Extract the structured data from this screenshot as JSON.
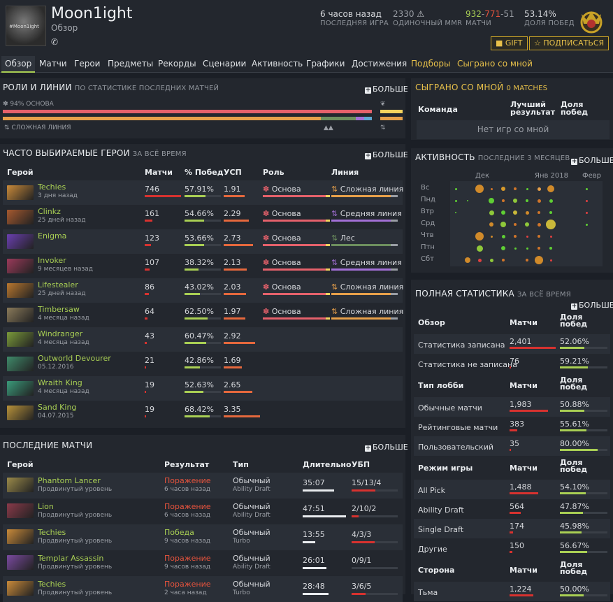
{
  "profile": {
    "name": "Moon1ight",
    "subtitle": "Обзор",
    "avatar_text": "#Moon1ight",
    "phone_icon": "phone-icon"
  },
  "stats": {
    "last_game": {
      "value": "6 часов назад",
      "label": "ПОСЛЕДНЯЯ ИГРА"
    },
    "mmr": {
      "value": "2330",
      "label": "ОДИНОЧНЫЙ MMR"
    },
    "matches": {
      "wins": "932",
      "losses": "771",
      "abandons": "51",
      "label": "МАТЧИ"
    },
    "winrate": {
      "value": "53.14%",
      "label": "ДОЛЯ ПОБЕД"
    }
  },
  "buttons": {
    "gift": "GIFT",
    "subscribe": "ПОДПИСАТЬСЯ"
  },
  "nav": [
    "Обзор",
    "Матчи",
    "Герои",
    "Предметы",
    "Рекорды",
    "Сценарии",
    "Активность",
    "Графики",
    "Достижения",
    "Подборы",
    "Сыграно со мной"
  ],
  "roles": {
    "title": "РОЛИ И ЛИНИИ",
    "subtitle": "ПО СТАТИСТИКЕ ПОСЛЕДНИХ МАТЧЕЙ",
    "more": "БОЛЬШЕ",
    "role_label": "94% ОСНОВА",
    "lane_label": "СЛОЖНАЯ ЛИНИЯ"
  },
  "played_with": {
    "title": "СЫГРАНО СО МНОЙ",
    "count": "0 MATCHES",
    "col_team": "Команда",
    "col_best": "Лучший результат",
    "col_winrate": "Доля побед",
    "empty": "Нет игр со мной"
  },
  "heroes": {
    "title": "ЧАСТО ВЫБИРАЕМЫЕ ГЕРОИ",
    "subtitle": "ЗА ВСЁ ВРЕМЯ",
    "more": "БОЛЬШЕ",
    "cols": {
      "hero": "Герой",
      "matches": "Матчи",
      "winrate": "% Побед",
      "kda": "УСП",
      "role": "Роль",
      "lane": "Линия"
    },
    "rows": [
      {
        "name": "Techies",
        "ago": "3 дня назад",
        "matches": "746",
        "m": 746,
        "winrate": "57.91%",
        "w": 57.91,
        "kda": "1.91",
        "k": 1.91,
        "role": "Основа",
        "lane": "Сложная линия",
        "lc": "#e7a04a",
        "c": "#c98a3a"
      },
      {
        "name": "Clinkz",
        "ago": "25 дней назад",
        "matches": "161",
        "m": 161,
        "winrate": "54.66%",
        "w": 54.66,
        "kda": "2.29",
        "k": 2.29,
        "role": "Основа",
        "lane": "Средняя линия",
        "lc": "#a26fd6",
        "c": "#a6592f"
      },
      {
        "name": "Enigma",
        "ago": "",
        "matches": "123",
        "m": 123,
        "winrate": "53.66%",
        "w": 53.66,
        "kda": "2.73",
        "k": 2.73,
        "role": "Основа",
        "lane": "Лес",
        "lc": "#6d8f5e",
        "c": "#6a3fb0"
      },
      {
        "name": "Invoker",
        "ago": "9 месяцев назад",
        "matches": "107",
        "m": 107,
        "winrate": "38.32%",
        "w": 38.32,
        "kda": "2.13",
        "k": 2.13,
        "role": "Основа",
        "lane": "Средняя линия",
        "lc": "#a26fd6",
        "c": "#9b3a5a"
      },
      {
        "name": "Lifestealer",
        "ago": "25 дней назад",
        "matches": "86",
        "m": 86,
        "winrate": "43.02%",
        "w": 43.02,
        "kda": "2.03",
        "k": 2.03,
        "role": "Основа",
        "lane": "Сложная линия",
        "lc": "#e7a04a",
        "c": "#b9772f"
      },
      {
        "name": "Timbersaw",
        "ago": "4 месяца назад",
        "matches": "64",
        "m": 64,
        "winrate": "62.50%",
        "w": 62.5,
        "kda": "1.97",
        "k": 1.97,
        "role": "Основа",
        "lane": "Сложная линия",
        "lc": "#e7a04a",
        "c": "#8a7a5a"
      },
      {
        "name": "Windranger",
        "ago": "4 месяца назад",
        "matches": "43",
        "m": 43,
        "winrate": "60.47%",
        "w": 60.47,
        "kda": "2.92",
        "k": 2.92,
        "role": "",
        "lane": "",
        "lc": "",
        "c": "#7a9a3a"
      },
      {
        "name": "Outworld Devourer",
        "ago": "05.12.2016",
        "matches": "21",
        "m": 21,
        "winrate": "42.86%",
        "w": 42.86,
        "kda": "1.69",
        "k": 1.69,
        "role": "",
        "lane": "",
        "lc": "",
        "c": "#3f8a6a"
      },
      {
        "name": "Wraith King",
        "ago": "4 месяца назад",
        "matches": "19",
        "m": 19,
        "winrate": "52.63%",
        "w": 52.63,
        "kda": "2.65",
        "k": 2.65,
        "role": "",
        "lane": "",
        "lc": "",
        "c": "#3a9a7a"
      },
      {
        "name": "Sand King",
        "ago": "04.07.2015",
        "matches": "19",
        "m": 19,
        "winrate": "68.42%",
        "w": 68.42,
        "kda": "3.35",
        "k": 3.35,
        "role": "",
        "lane": "",
        "lc": "",
        "c": "#b8923a"
      }
    ]
  },
  "recent": {
    "title": "ПОСЛЕДНИЕ МАТЧИ",
    "more": "БОЛЬШЕ",
    "cols": {
      "hero": "Герой",
      "result": "Результат",
      "type": "Тип",
      "duration": "Длительность",
      "kda": "УБП"
    },
    "rows": [
      {
        "name": "Phantom Lancer",
        "level": "Продвинутый уровень",
        "result": "Поражение",
        "win": false,
        "ago": "6 часов назад",
        "type": "Обычный",
        "mode": "Ability Draft",
        "duration": "35:07",
        "d": 35.1,
        "kda": "15/13/4",
        "k": 15,
        "dd": 13,
        "c": "#9a8a4a"
      },
      {
        "name": "Lion",
        "level": "Продвинутый уровень",
        "result": "Поражение",
        "win": false,
        "ago": "6 часов назад",
        "type": "Обычный",
        "mode": "Ability Draft",
        "duration": "47:51",
        "d": 47.85,
        "kda": "2/10/2",
        "k": 2,
        "dd": 10,
        "c": "#8a3a4a"
      },
      {
        "name": "Techies",
        "level": "Продвинутый уровень",
        "result": "Победа",
        "win": true,
        "ago": "9 часов назад",
        "type": "Обычный",
        "mode": "Turbo",
        "duration": "13:55",
        "d": 13.9,
        "kda": "4/3/3",
        "k": 4,
        "dd": 3,
        "c": "#c98a3a"
      },
      {
        "name": "Templar Assassin",
        "level": "Продвинутый уровень",
        "result": "Поражение",
        "win": false,
        "ago": "9 часов назад",
        "type": "Обычный",
        "mode": "Ability Draft",
        "duration": "26:01",
        "d": 26,
        "kda": "0/9/1",
        "k": 0,
        "dd": 9,
        "c": "#7a4aa0"
      },
      {
        "name": "Techies",
        "level": "Продвинутый уровень",
        "result": "Поражение",
        "win": false,
        "ago": "2 часа назад",
        "type": "Обычный",
        "mode": "Turbo",
        "duration": "28:48",
        "d": 28.8,
        "kda": "3/6/5",
        "k": 3,
        "dd": 6,
        "c": "#c98a3a"
      }
    ]
  },
  "activity": {
    "title": "АКТИВНОСТЬ",
    "subtitle": "ПОСЛЕДНИЕ 3 МЕСЯЦЕВ",
    "more": "БОЛЬШЕ",
    "months": [
      "Дек",
      "Янв 2018",
      "Февр"
    ],
    "days": [
      "Вс",
      "Пнд",
      "Втр",
      "Срд",
      "Чтв",
      "Птн",
      "Сбт"
    ]
  },
  "full": {
    "title": "ПОЛНАЯ СТАТИСТИКА",
    "subtitle": "ЗА ВСЁ ВРЕМЯ",
    "more": "БОЛЬШЕ",
    "groups": [
      {
        "head": "Обзор",
        "rows": [
          {
            "label": "Статистика записана",
            "matches": "2,401",
            "m": 2401,
            "winrate": "52.06%",
            "w": 52.06
          },
          {
            "label": "Статистика не записана",
            "matches": "76",
            "m": 76,
            "winrate": "59.21%",
            "w": 59.21
          }
        ]
      },
      {
        "head": "Тип лобби",
        "rows": [
          {
            "label": "Обычные матчи",
            "matches": "1,983",
            "m": 1983,
            "winrate": "50.88%",
            "w": 50.88
          },
          {
            "label": "Рейтинговые матчи",
            "matches": "383",
            "m": 383,
            "winrate": "55.61%",
            "w": 55.61
          },
          {
            "label": "Пользовательский",
            "matches": "35",
            "m": 35,
            "winrate": "80.00%",
            "w": 80
          }
        ]
      },
      {
        "head": "Режим игры",
        "rows": [
          {
            "label": "All Pick",
            "matches": "1,488",
            "m": 1488,
            "winrate": "54.10%",
            "w": 54.1
          },
          {
            "label": "Ability Draft",
            "matches": "564",
            "m": 564,
            "winrate": "47.87%",
            "w": 47.87
          },
          {
            "label": "Single Draft",
            "matches": "174",
            "m": 174,
            "winrate": "45.98%",
            "w": 45.98
          },
          {
            "label": "Другие",
            "matches": "150",
            "m": 150,
            "winrate": "56.67%",
            "w": 56.67
          }
        ]
      },
      {
        "head": "Сторона",
        "rows": [
          {
            "label": "Тьма",
            "matches": "1,224",
            "m": 1224,
            "winrate": "50.00%",
            "w": 50
          }
        ]
      }
    ],
    "col_matches": "Матчи",
    "col_winrate": "Доля побед"
  }
}
